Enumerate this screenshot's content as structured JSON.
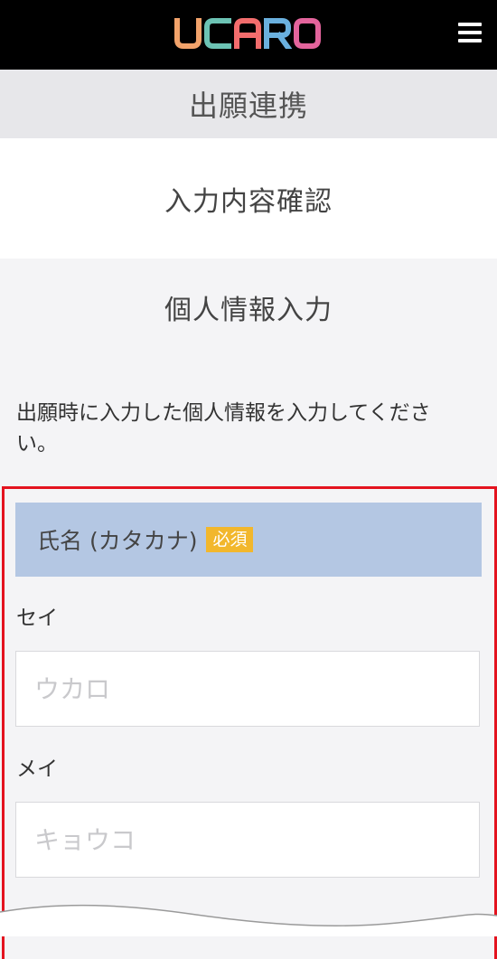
{
  "header": {
    "logo_text": "UCARO",
    "logo_colors": [
      "#f2a36b",
      "#6cc3b4",
      "#f26d6d",
      "#6ab0de",
      "#e3649c"
    ],
    "menu_icon": "hamburger-icon"
  },
  "page_title": "出願連携",
  "tabs": {
    "confirm_label": "入力内容確認"
  },
  "section": {
    "title": "個人情報入力",
    "instructions": "出願時に入力した個人情報を入力してください。"
  },
  "form": {
    "name_kana": {
      "label": "氏名 (カタカナ)",
      "required_badge": "必須",
      "sei_label": "セイ",
      "sei_placeholder": "ウカロ",
      "mei_label": "メイ",
      "mei_placeholder": "キョウコ"
    }
  },
  "colors": {
    "highlight_border": "#e4131f",
    "field_header_bg": "#b4c7e3",
    "badge_bg": "#f2b72c"
  }
}
